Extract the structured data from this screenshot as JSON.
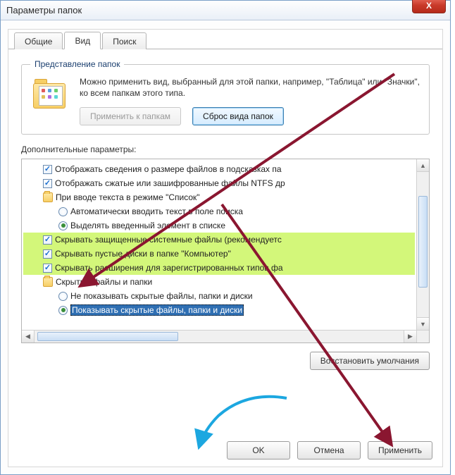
{
  "window": {
    "title": "Параметры папок",
    "close": "X"
  },
  "tabs": {
    "general": "Общие",
    "view": "Вид",
    "search": "Поиск"
  },
  "folderView": {
    "legend": "Представление папок",
    "description": "Можно применить вид, выбранный для этой папки, например, \"Таблица\" или \"Значки\", ко всем папкам этого типа.",
    "applyBtn": "Применить к папкам",
    "resetBtn": "Сброс вида папок"
  },
  "advanced": {
    "label": "Дополнительные параметры:",
    "items": [
      {
        "type": "checkbox",
        "checked": true,
        "indent": 1,
        "hl": false,
        "text": "Отображать сведения о размере файлов в подсказках па"
      },
      {
        "type": "checkbox",
        "checked": true,
        "indent": 1,
        "hl": false,
        "text": "Отображать сжатые или зашифрованные файлы NTFS др"
      },
      {
        "type": "folder",
        "checked": false,
        "indent": 1,
        "hl": false,
        "text": "При вводе текста в режиме \"Список\""
      },
      {
        "type": "radio",
        "checked": false,
        "indent": 2,
        "hl": false,
        "text": "Автоматически вводить текст в поле поиска"
      },
      {
        "type": "radio",
        "checked": true,
        "indent": 2,
        "hl": false,
        "text": "Выделять введенный элемент в списке"
      },
      {
        "type": "checkbox",
        "checked": true,
        "indent": 1,
        "hl": true,
        "text": "Скрывать защищенные системные файлы (рекомендуетс"
      },
      {
        "type": "checkbox",
        "checked": true,
        "indent": 1,
        "hl": true,
        "text": "Скрывать пустые диски в папке \"Компьютер\""
      },
      {
        "type": "checkbox",
        "checked": true,
        "indent": 1,
        "hl": true,
        "text": "Скрывать расширения для зарегистрированных типов фа"
      },
      {
        "type": "folder",
        "checked": false,
        "indent": 1,
        "hl": false,
        "text": "Скрытые файлы и папки"
      },
      {
        "type": "radio",
        "checked": false,
        "indent": 2,
        "hl": false,
        "text": "Не показывать скрытые файлы, папки и диски"
      },
      {
        "type": "radio",
        "checked": true,
        "indent": 2,
        "hl": false,
        "sel": true,
        "text": "Показывать скрытые файлы, папки и диски"
      }
    ]
  },
  "restoreDefaults": "Восстановить умолчания",
  "buttons": {
    "ok": "OK",
    "cancel": "Отмена",
    "apply": "Применить"
  }
}
